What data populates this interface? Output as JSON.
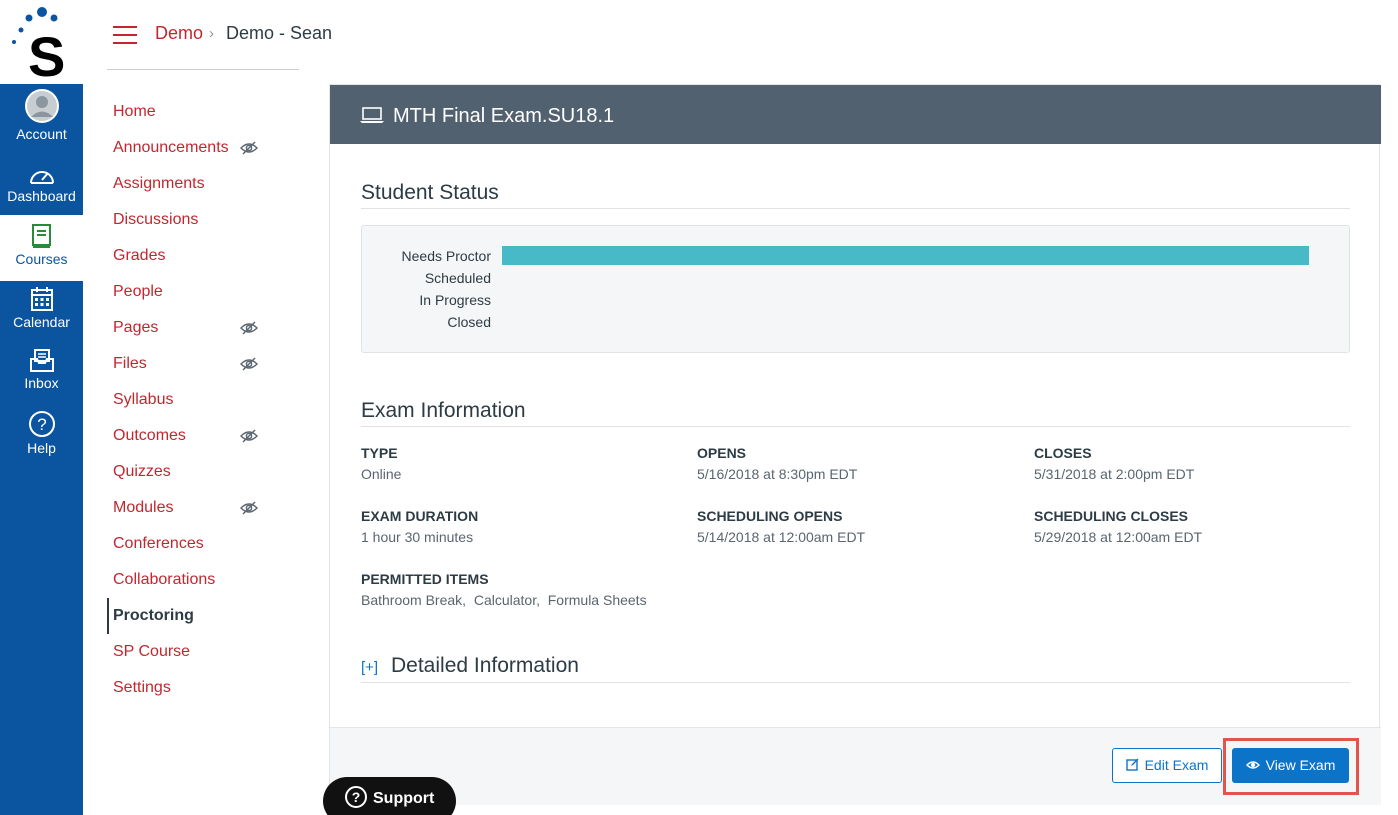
{
  "global_nav": {
    "items": [
      {
        "label": "Account",
        "icon": "avatar-icon"
      },
      {
        "label": "Dashboard",
        "icon": "dashboard-icon"
      },
      {
        "label": "Courses",
        "icon": "courses-icon"
      },
      {
        "label": "Calendar",
        "icon": "calendar-icon"
      },
      {
        "label": "Inbox",
        "icon": "inbox-icon"
      },
      {
        "label": "Help",
        "icon": "help-icon"
      }
    ],
    "active": "Courses",
    "brand_color": "#0b55a0"
  },
  "breadcrumb": {
    "course": "Demo",
    "separator": "›",
    "current": "Demo - Sean"
  },
  "course_nav": {
    "items": [
      {
        "label": "Home",
        "hidden": false
      },
      {
        "label": "Announcements",
        "hidden": true
      },
      {
        "label": "Assignments",
        "hidden": false
      },
      {
        "label": "Discussions",
        "hidden": false
      },
      {
        "label": "Grades",
        "hidden": false
      },
      {
        "label": "People",
        "hidden": false
      },
      {
        "label": "Pages",
        "hidden": true
      },
      {
        "label": "Files",
        "hidden": true
      },
      {
        "label": "Syllabus",
        "hidden": false
      },
      {
        "label": "Outcomes",
        "hidden": true
      },
      {
        "label": "Quizzes",
        "hidden": false
      },
      {
        "label": "Modules",
        "hidden": true
      },
      {
        "label": "Conferences",
        "hidden": false
      },
      {
        "label": "Collaborations",
        "hidden": false
      },
      {
        "label": "Proctoring",
        "hidden": false
      },
      {
        "label": "SP Course",
        "hidden": false
      },
      {
        "label": "Settings",
        "hidden": false
      }
    ],
    "active": "Proctoring",
    "link_color": "#c0282f"
  },
  "exam": {
    "title": "MTH Final Exam.SU18.1",
    "student_status": {
      "heading": "Student Status",
      "rows": [
        {
          "label": "Needs Proctor",
          "fraction": 1.0
        },
        {
          "label": "Scheduled",
          "fraction": 0
        },
        {
          "label": "In Progress",
          "fraction": 0
        },
        {
          "label": "Closed",
          "fraction": 0
        }
      ],
      "bar_color": "#47b9c7"
    },
    "info": {
      "heading": "Exam Information",
      "type_label": "TYPE",
      "type_value": "Online",
      "opens_label": "OPENS",
      "opens_value": "5/16/2018 at 8:30pm EDT",
      "closes_label": "CLOSES",
      "closes_value": "5/31/2018 at 2:00pm EDT",
      "duration_label": "EXAM DURATION",
      "duration_value": "1 hour 30 minutes",
      "sched_opens_label": "SCHEDULING OPENS",
      "sched_opens_value": "5/14/2018 at 12:00am EDT",
      "sched_closes_label": "SCHEDULING CLOSES",
      "sched_closes_value": "5/29/2018 at 12:00am EDT",
      "permitted_label": "PERMITTED ITEMS",
      "permitted_value": "Bathroom Break,  Calculator,  Formula Sheets"
    },
    "detailed": {
      "toggle": "[+]",
      "heading": "Detailed Information"
    },
    "footer": {
      "edit_label": "Edit Exam",
      "view_label": "View Exam"
    }
  },
  "support": {
    "label": "Support"
  },
  "colors": {
    "header_bar": "#526170",
    "primary_button": "#0b74c9",
    "highlight": "#e3554b"
  }
}
